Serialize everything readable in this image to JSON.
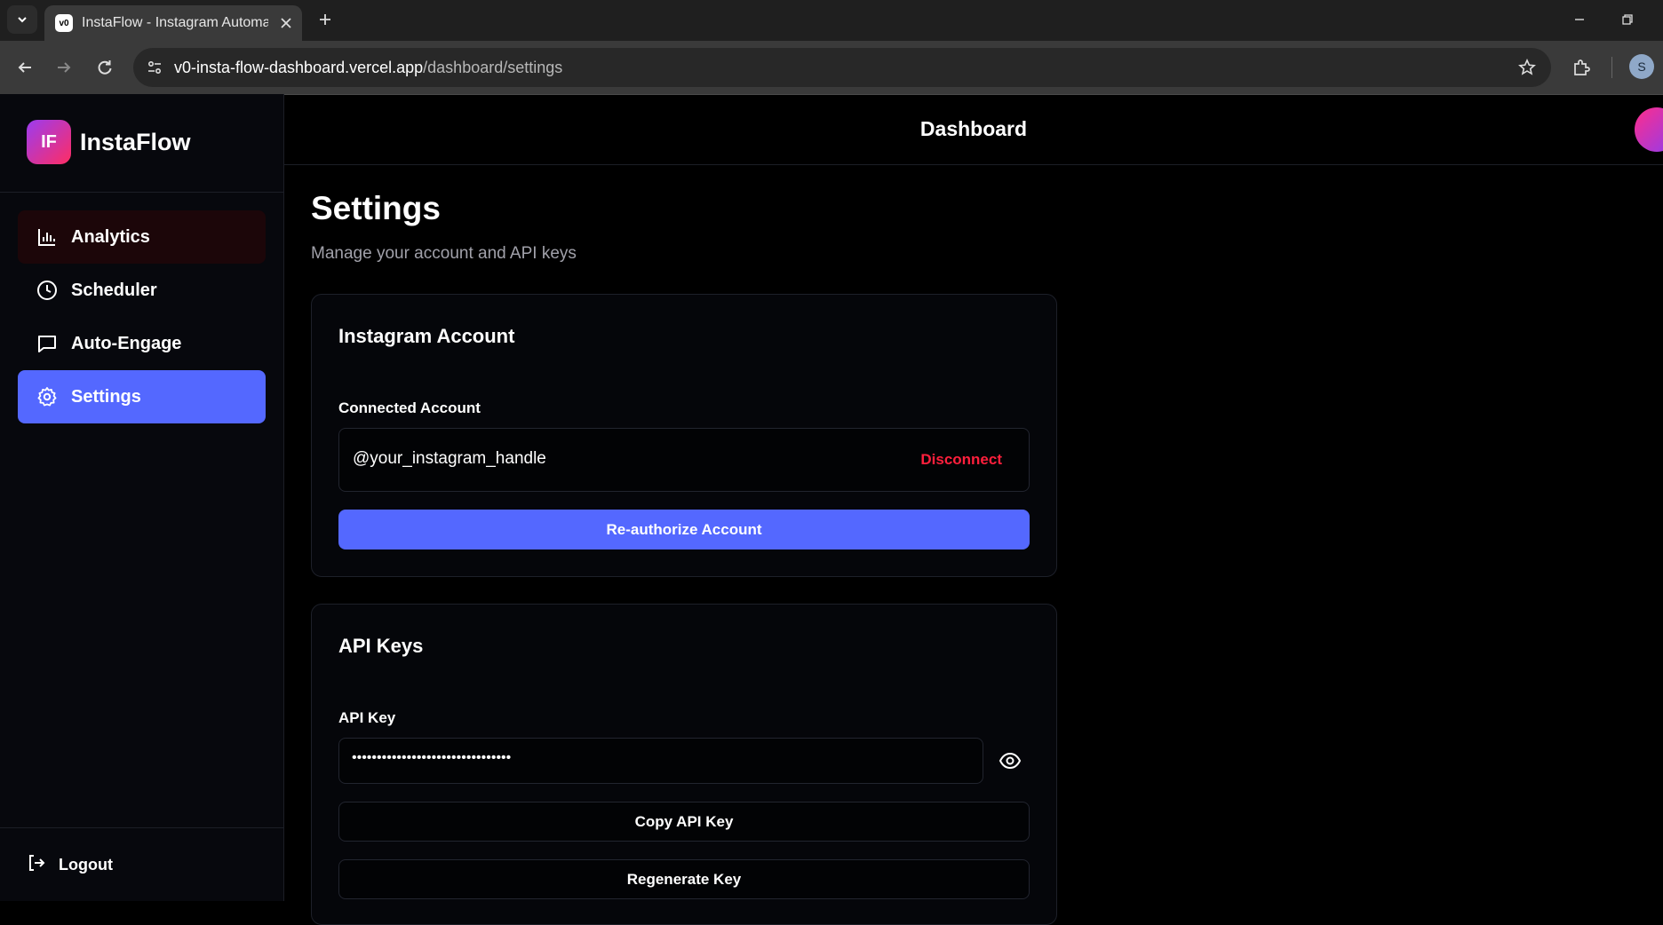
{
  "browser": {
    "tab_title": "InstaFlow - Instagram Automation Dashboard",
    "favicon_text": "v0",
    "url_host": "v0-insta-flow-dashboard.vercel.app",
    "url_path": "/dashboard/settings",
    "profile_initial": "S"
  },
  "brand": {
    "logo_text": "IF",
    "name": "InstaFlow"
  },
  "sidebar": {
    "items": [
      {
        "label": "Analytics",
        "icon": "bar-chart-icon"
      },
      {
        "label": "Scheduler",
        "icon": "clock-icon"
      },
      {
        "label": "Auto-Engage",
        "icon": "message-square-icon"
      },
      {
        "label": "Settings",
        "icon": "gear-icon",
        "active": true
      }
    ],
    "logout_label": "Logout"
  },
  "header": {
    "title": "Dashboard"
  },
  "page": {
    "title": "Settings",
    "subtitle": "Manage your account and API keys"
  },
  "instagram_card": {
    "title": "Instagram Account",
    "connected_label": "Connected Account",
    "handle": "@your_instagram_handle",
    "disconnect_label": "Disconnect",
    "reauthorize_label": "Re-authorize Account"
  },
  "api_card": {
    "title": "API Keys",
    "key_label": "API Key",
    "key_masked": "••••••••••••••••••••••••••••••••",
    "copy_label": "Copy API Key",
    "regenerate_label": "Regenerate Key"
  },
  "colors": {
    "accent": "#5468ff",
    "danger": "#ff1f3c",
    "background": "#000000"
  }
}
